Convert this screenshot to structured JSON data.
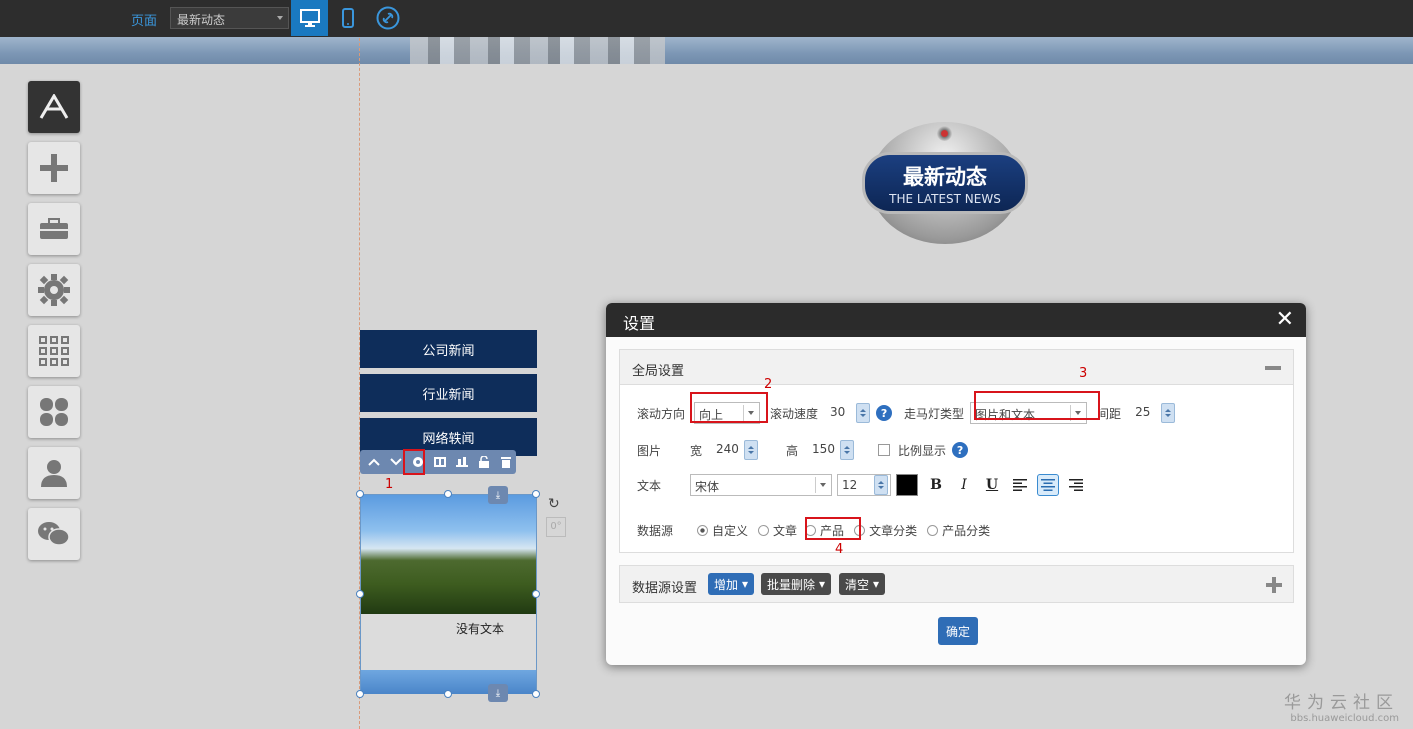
{
  "topbar": {
    "page_label": "页面",
    "page_select_value": "最新动态",
    "devices": [
      "desktop-icon",
      "mobile-icon",
      "link-icon"
    ]
  },
  "sidebar_tools": [
    "app-store-icon",
    "add-icon",
    "toolbox-icon",
    "gear-icon",
    "grid-icon",
    "clover-icon",
    "user-icon",
    "wechat-icon"
  ],
  "badge": {
    "title_cn": "最新动态",
    "title_en": "THE LATEST NEWS"
  },
  "news_nav": [
    "公司新闻",
    "行业新闻",
    "网络轶闻"
  ],
  "element": {
    "no_text": "没有文本",
    "toolbar_icons": [
      "chevron-up-icon",
      "chevron-down-icon",
      "gear-icon",
      "layer-icon",
      "align-icon",
      "lock-icon",
      "trash-icon"
    ]
  },
  "annotations": [
    "1",
    "2",
    "3",
    "4"
  ],
  "dialog": {
    "title": "设置",
    "global_settings": "全局设置",
    "scroll_direction_label": "滚动方向",
    "scroll_direction_value": "向上",
    "scroll_speed_label": "滚动速度",
    "scroll_speed_value": "30",
    "marquee_type_label": "走马灯类型",
    "marquee_type_value": "图片和文本",
    "spacing_label": "间距",
    "spacing_value": "25",
    "image_label": "图片",
    "width_label": "宽",
    "width_value": "240",
    "height_label": "高",
    "height_value": "150",
    "ratio_label": "比例显示",
    "text_label": "文本",
    "font_value": "宋体",
    "font_size_value": "12",
    "text_color": "#000000",
    "bold": "B",
    "italic": "I",
    "underline": "U",
    "data_source_label": "数据源",
    "data_source_options": [
      "自定义",
      "文章",
      "产品",
      "文章分类",
      "产品分类"
    ],
    "data_source_selected": "自定义",
    "data_source_settings": "数据源设置",
    "add_button": "增加",
    "batch_delete_button": "批量删除",
    "clear_button": "清空",
    "confirm_button": "确定",
    "help": "?"
  },
  "watermark": {
    "cn": "华为云社区",
    "en": "bbs.huaweicloud.com"
  },
  "colors": {
    "accent": "#1a79c0",
    "nav_bg": "#0e2d5a",
    "annotation_red": "#d8141b"
  }
}
